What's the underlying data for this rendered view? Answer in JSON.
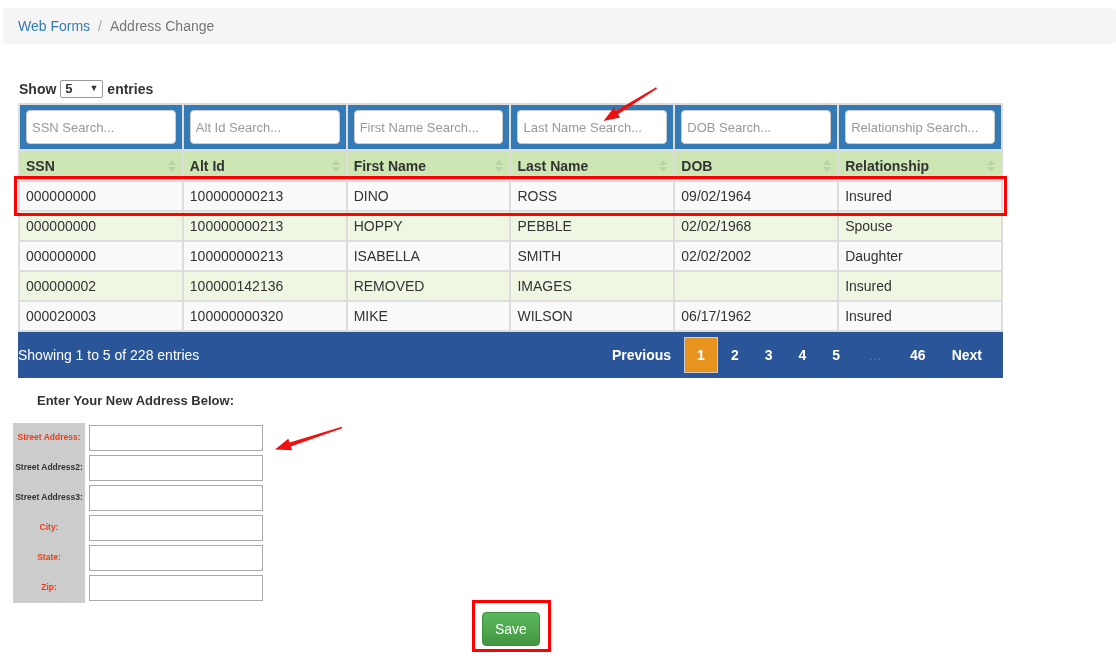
{
  "breadcrumb": [
    {
      "label": "Web Forms",
      "kind": "link"
    },
    {
      "label": "/",
      "kind": "separator"
    },
    {
      "label": "Address Change",
      "kind": "current"
    }
  ],
  "length_menu": {
    "before": "Show",
    "value": "5",
    "caret": "▼",
    "after": "entries"
  },
  "table": {
    "search_fields": [
      {
        "placeholder": "SSN Search...",
        "annotated": false
      },
      {
        "placeholder": "Alt Id Search...",
        "annotated": false
      },
      {
        "placeholder": "First Name Search...",
        "annotated": false
      },
      {
        "placeholder": "Last Name Search...",
        "annotated": true
      },
      {
        "placeholder": "DOB Search...",
        "annotated": false
      },
      {
        "placeholder": "Relationship Search...",
        "annotated": false
      }
    ],
    "columns": [
      "SSN",
      "Alt Id",
      "First Name",
      "Last Name",
      "DOB",
      "Relationship"
    ],
    "rows": [
      {
        "cells": [
          "000000000",
          "100000000213",
          "DINO",
          "ROSS",
          "09/02/1964",
          "Insured"
        ],
        "highlighted": true
      },
      {
        "cells": [
          "000000000",
          "100000000213",
          "HOPPY",
          "PEBBLE",
          "02/02/1968",
          "Spouse"
        ],
        "highlighted": false
      },
      {
        "cells": [
          "000000000",
          "100000000213",
          "ISABELLA",
          "SMITH",
          "02/02/2002",
          "Daughter"
        ],
        "highlighted": false
      },
      {
        "cells": [
          "000000002",
          "100000142136",
          "REMOVED",
          "IMAGES",
          "",
          "Insured"
        ],
        "highlighted": false
      },
      {
        "cells": [
          "000020003",
          "100000000320",
          "MIKE",
          "WILSON",
          "06/17/1962",
          "Insured"
        ],
        "highlighted": false
      }
    ]
  },
  "info": "Showing 1 to 5 of 228 entries",
  "pagination": [
    {
      "label": "Previous",
      "kind": "nav",
      "selected": false
    },
    {
      "label": "1",
      "kind": "page",
      "selected": true
    },
    {
      "label": "2",
      "kind": "page",
      "selected": false
    },
    {
      "label": "3",
      "kind": "page",
      "selected": false
    },
    {
      "label": "4",
      "kind": "page",
      "selected": false
    },
    {
      "label": "5",
      "kind": "page",
      "selected": false
    },
    {
      "label": "…",
      "kind": "ellipsis"
    },
    {
      "label": "46",
      "kind": "page",
      "selected": false
    },
    {
      "label": "Next",
      "kind": "nav",
      "selected": false
    }
  ],
  "form": {
    "title": "Enter Your New Address Below:",
    "fields": [
      {
        "label": "Street Address:",
        "required": true,
        "annotated": true
      },
      {
        "label": "Street Address2:",
        "required": false,
        "annotated": false
      },
      {
        "label": "Street Address3:",
        "required": false,
        "annotated": false
      },
      {
        "label": "City:",
        "required": true,
        "annotated": false
      },
      {
        "label": "State:",
        "required": true,
        "annotated": false
      },
      {
        "label": "Zip:",
        "required": true,
        "annotated": false
      }
    ]
  },
  "save_button": {
    "label": "Save",
    "highlighted": true
  }
}
